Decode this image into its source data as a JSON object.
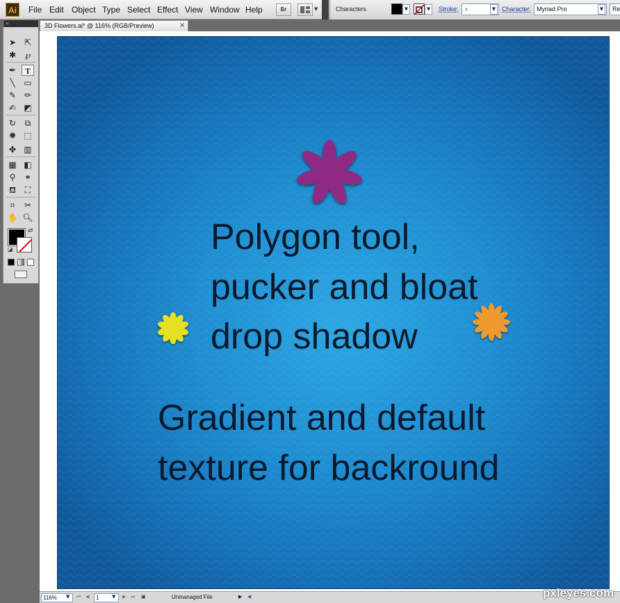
{
  "app": {
    "logo": "Ai",
    "menu": [
      "File",
      "Edit",
      "Object",
      "Type",
      "Select",
      "Effect",
      "View",
      "Window",
      "Help"
    ],
    "bridge_button": "Br"
  },
  "control_panel": {
    "section_label": "Characters",
    "fill_color": "#000000",
    "stroke_label": "Stroke:",
    "character_label": "Character:",
    "font_value": "Myriad Pro",
    "style_value_clipped": "Re"
  },
  "toolbox": {
    "collapse_glyph": "«"
  },
  "document": {
    "tab_title": "3D Flowers.ai* @ 116% (RGB/Preview)",
    "close_glyph": "×"
  },
  "artwork": {
    "background_colors": [
      "#2ea8e3",
      "#1670b6",
      "#105a9c"
    ],
    "text_color": "#0b1a2c",
    "lines": [
      "Polygon tool,",
      "pucker and bloat",
      "drop shadow",
      "Gradient and default",
      "texture for backround"
    ],
    "flowers": [
      {
        "name": "purple-flower",
        "color": "#8e2a82"
      },
      {
        "name": "yellow-flower",
        "color": "#e6e021"
      },
      {
        "name": "orange-flower",
        "color": "#ee9a2f"
      }
    ]
  },
  "statusbar": {
    "zoom_value": "116%",
    "artboard_value": "1",
    "status_text": "Unmanaged File"
  },
  "watermark": "pxleyes.com"
}
